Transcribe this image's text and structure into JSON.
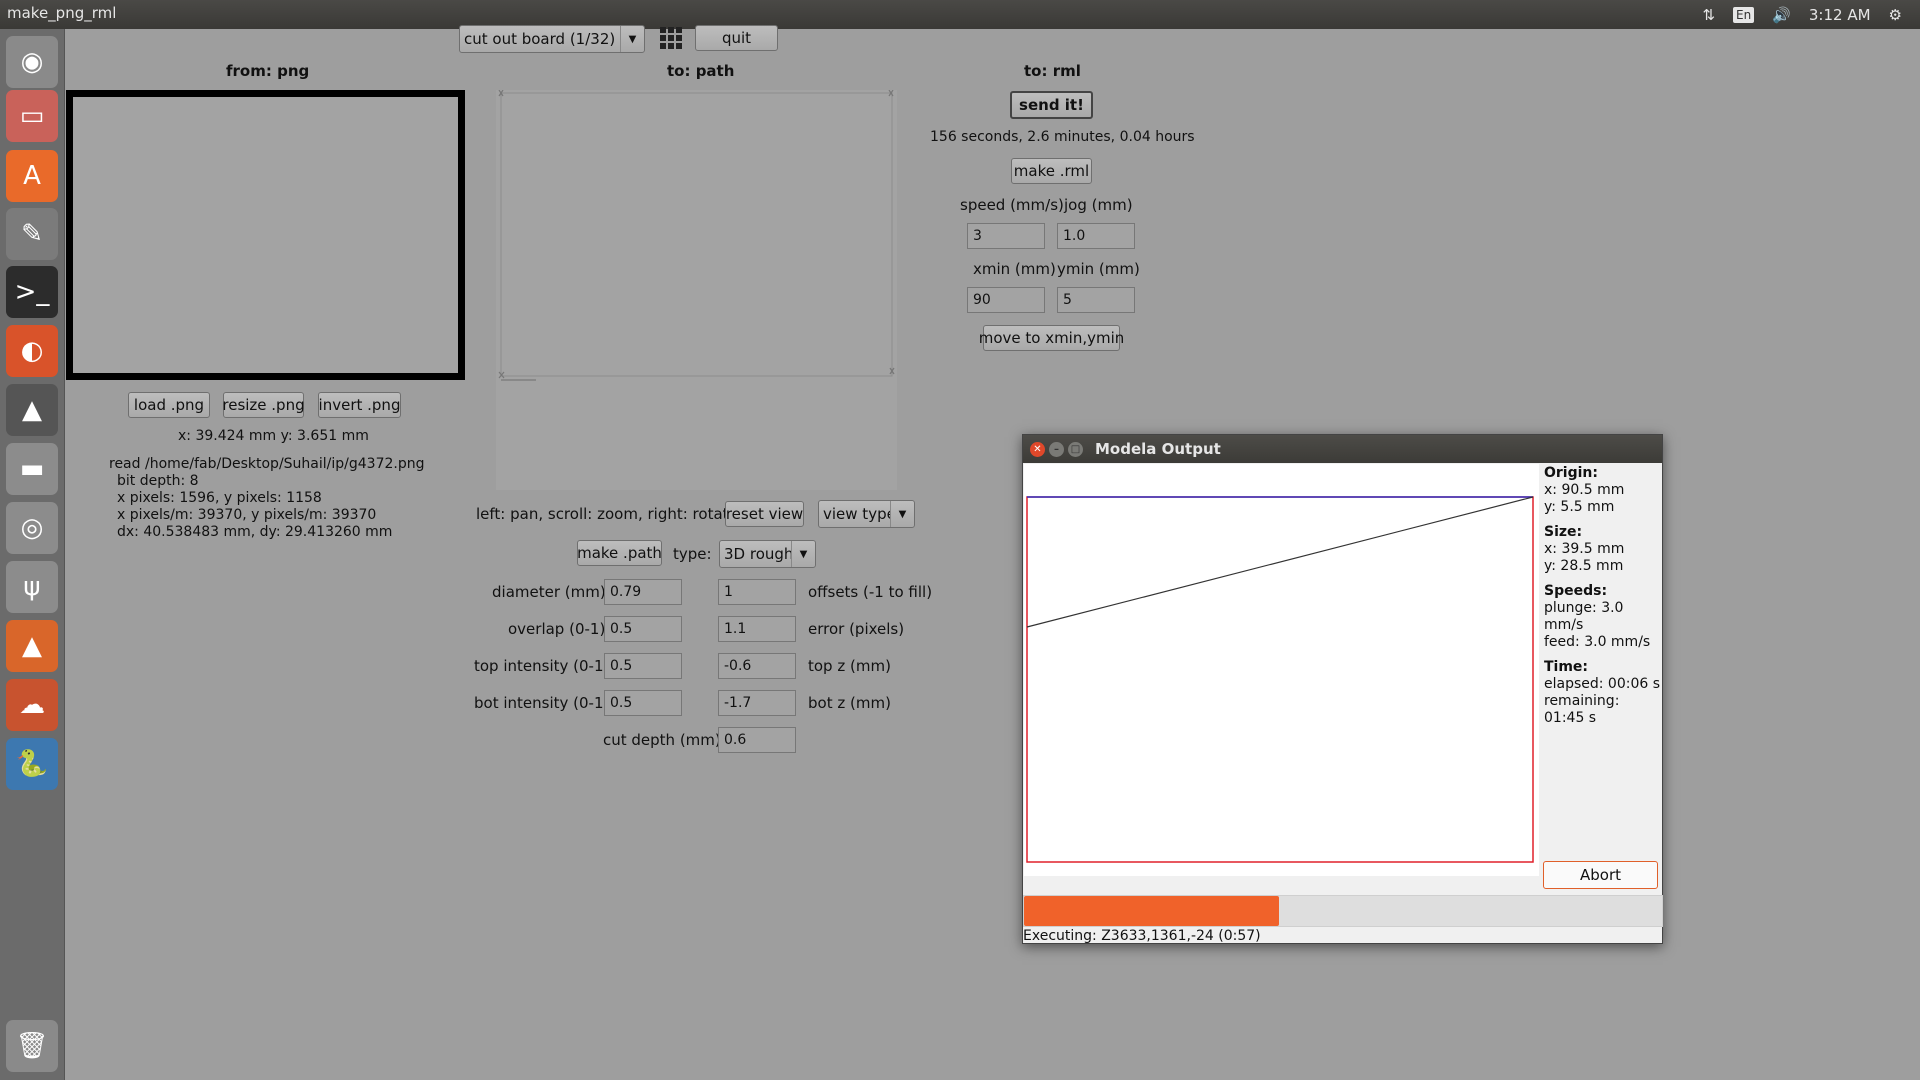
{
  "topbar": {
    "title": "make_png_rml",
    "keyboard": "En",
    "clock": "3:12 AM"
  },
  "launcher": {
    "icons": [
      "ubuntu-dash-icon",
      "files-icon",
      "software-center-icon",
      "system-settings-icon",
      "terminal-icon",
      "firefox-icon",
      "inkscape-icon",
      "disk-icon",
      "dvd-icon",
      "usb-icon",
      "vlc-icon",
      "ubuntu-one-icon",
      "python-icon",
      "trash-icon"
    ]
  },
  "toolbar": {
    "process": "cut out board (1/32)",
    "quit": "quit"
  },
  "png_panel": {
    "heading": "from: png",
    "load": "load .png",
    "resize": "resize .png",
    "invert": "invert .png",
    "coords": "x: 39.424 mm  y: 3.651 mm",
    "info": [
      "read /home/fab/Desktop/Suhail/ip/g4372.png",
      "bit depth: 8",
      "x pixels: 1596, y pixels: 1158",
      "x pixels/m: 39370, y pixels/m: 39370",
      "dx: 40.538483 mm, dy: 29.413260 mm"
    ]
  },
  "path_panel": {
    "heading": "to: path",
    "hint": "left: pan, scroll: zoom, right: rotate",
    "reset_view": "reset view",
    "view_type": "view type",
    "make_path": "make .path",
    "type_label": "type:",
    "type_value": "3D rough",
    "diameter_label": "diameter (mm)",
    "diameter": "0.79",
    "overlap_label": "overlap (0-1)",
    "overlap": "0.5",
    "top_int_label": "top intensity (0-1)",
    "top_int": "0.5",
    "bot_int_label": "bot intensity (0-1)",
    "bot_int": "0.5",
    "offsets_label": "offsets (-1 to fill)",
    "offsets": "1",
    "error_label": "error (pixels)",
    "error": "1.1",
    "topz_label": "top z (mm)",
    "topz": "-0.6",
    "botz_label": "bot z (mm)",
    "botz": "-1.7",
    "cut_depth_label": "cut depth (mm)",
    "cut_depth": "0.6"
  },
  "rml_panel": {
    "heading": "to: rml",
    "send": "send it!",
    "time": "156 seconds, 2.6 minutes, 0.04 hours",
    "make_rml": "make .rml",
    "speed_label": "speed (mm/s)",
    "speed": "3",
    "jog_label": "jog (mm)",
    "jog": "1.0",
    "xmin_label": "xmin (mm)",
    "xmin": "90",
    "ymin_label": "ymin (mm)",
    "ymin": "5",
    "move": "move to xmin,ymin"
  },
  "modela": {
    "title": "Modela Output",
    "origin_h": "Origin:",
    "origin_x": "x: 90.5 mm",
    "origin_y": "y: 5.5 mm",
    "size_h": "Size:",
    "size_x": "x: 39.5 mm",
    "size_y": "y: 28.5 mm",
    "speeds_h": "Speeds:",
    "plunge": "plunge: 3.0 mm/s",
    "feed": "feed: 3.0 mm/s",
    "time_h": "Time:",
    "elapsed": "elapsed: 00:06 s",
    "remaining": "remaining: 01:45 s",
    "abort": "Abort",
    "progress": 0.4,
    "status": "Executing: Z3633,1361,-24 (0:57)"
  },
  "colors": {
    "progress": "#f0622a",
    "frame_red": "#e0202a",
    "frame_blue": "#3030c0"
  }
}
